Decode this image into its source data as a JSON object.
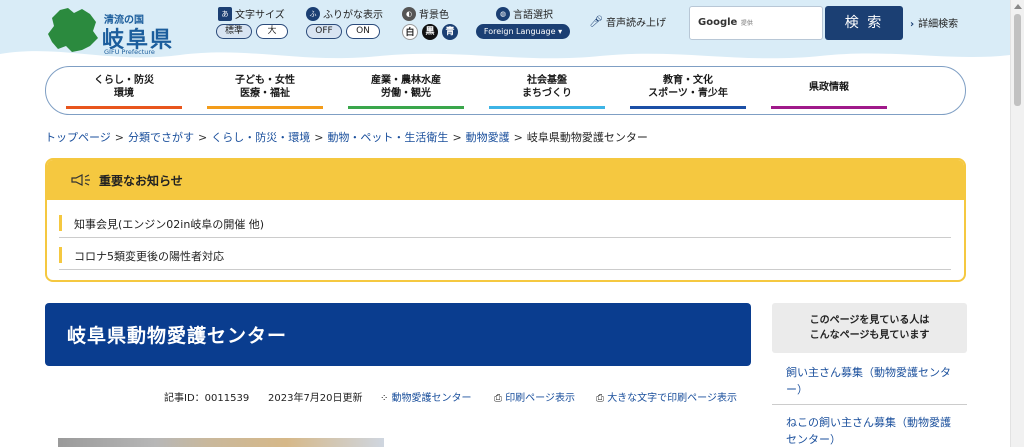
{
  "header": {
    "logo_sub": "清流の国",
    "logo_main": "岐阜県",
    "logo_en": "GIFU Prefecture",
    "font_size": {
      "label": "文字サイズ",
      "options": [
        "標準",
        "大"
      ]
    },
    "furigana": {
      "label": "ふりがな表示",
      "options": [
        "OFF",
        "ON"
      ]
    },
    "bg_color": {
      "label": "背景色",
      "options": [
        "白",
        "黒",
        "青"
      ]
    },
    "language": {
      "label": "言語選択",
      "button": "Foreign Language"
    },
    "speech": {
      "label": "音声読み上げ"
    },
    "search": {
      "google": "Google",
      "provided": "提供",
      "button": "検 索",
      "advanced": "詳細検索"
    }
  },
  "nav": [
    {
      "l1": "くらし・防災",
      "l2": "環境",
      "color": "#e8551c"
    },
    {
      "l1": "子ども・女性",
      "l2": "医療・福祉",
      "color": "#f39c1a"
    },
    {
      "l1": "産業・農林水産",
      "l2": "労働・観光",
      "color": "#3aa64b"
    },
    {
      "l1": "社会基盤",
      "l2": "まちづくり",
      "color": "#3db4e6"
    },
    {
      "l1": "教育・文化",
      "l2": "スポーツ・青少年",
      "color": "#1b4fa6"
    },
    {
      "l1": "県政情報",
      "l2": "",
      "color": "#a0198a"
    }
  ],
  "breadcrumb": [
    "トップページ",
    "分類でさがす",
    "くらし・防災・環境",
    "動物・ペット・生活衛生",
    "動物愛護",
    "岐阜県動物愛護センター"
  ],
  "notice": {
    "title": "重要なお知らせ",
    "items": [
      "知事会見(エンジン02in岐阜の開催 他)",
      "コロナ5類変更後の陽性者対応"
    ]
  },
  "page": {
    "title": "岐阜県動物愛護センター",
    "article_id": "記事ID：0011539",
    "updated": "2023年7月20日更新",
    "links": [
      "動物愛護センター",
      "印刷ページ表示",
      "大きな文字で印刷ページ表示"
    ]
  },
  "sidebar": {
    "heading1": "このページを見ている人は",
    "heading2": "こんなページも見ています",
    "items": [
      "飼い主さん募集（動物愛護センター）",
      "ねこの飼い主さん募集（動物愛護センター）"
    ]
  }
}
